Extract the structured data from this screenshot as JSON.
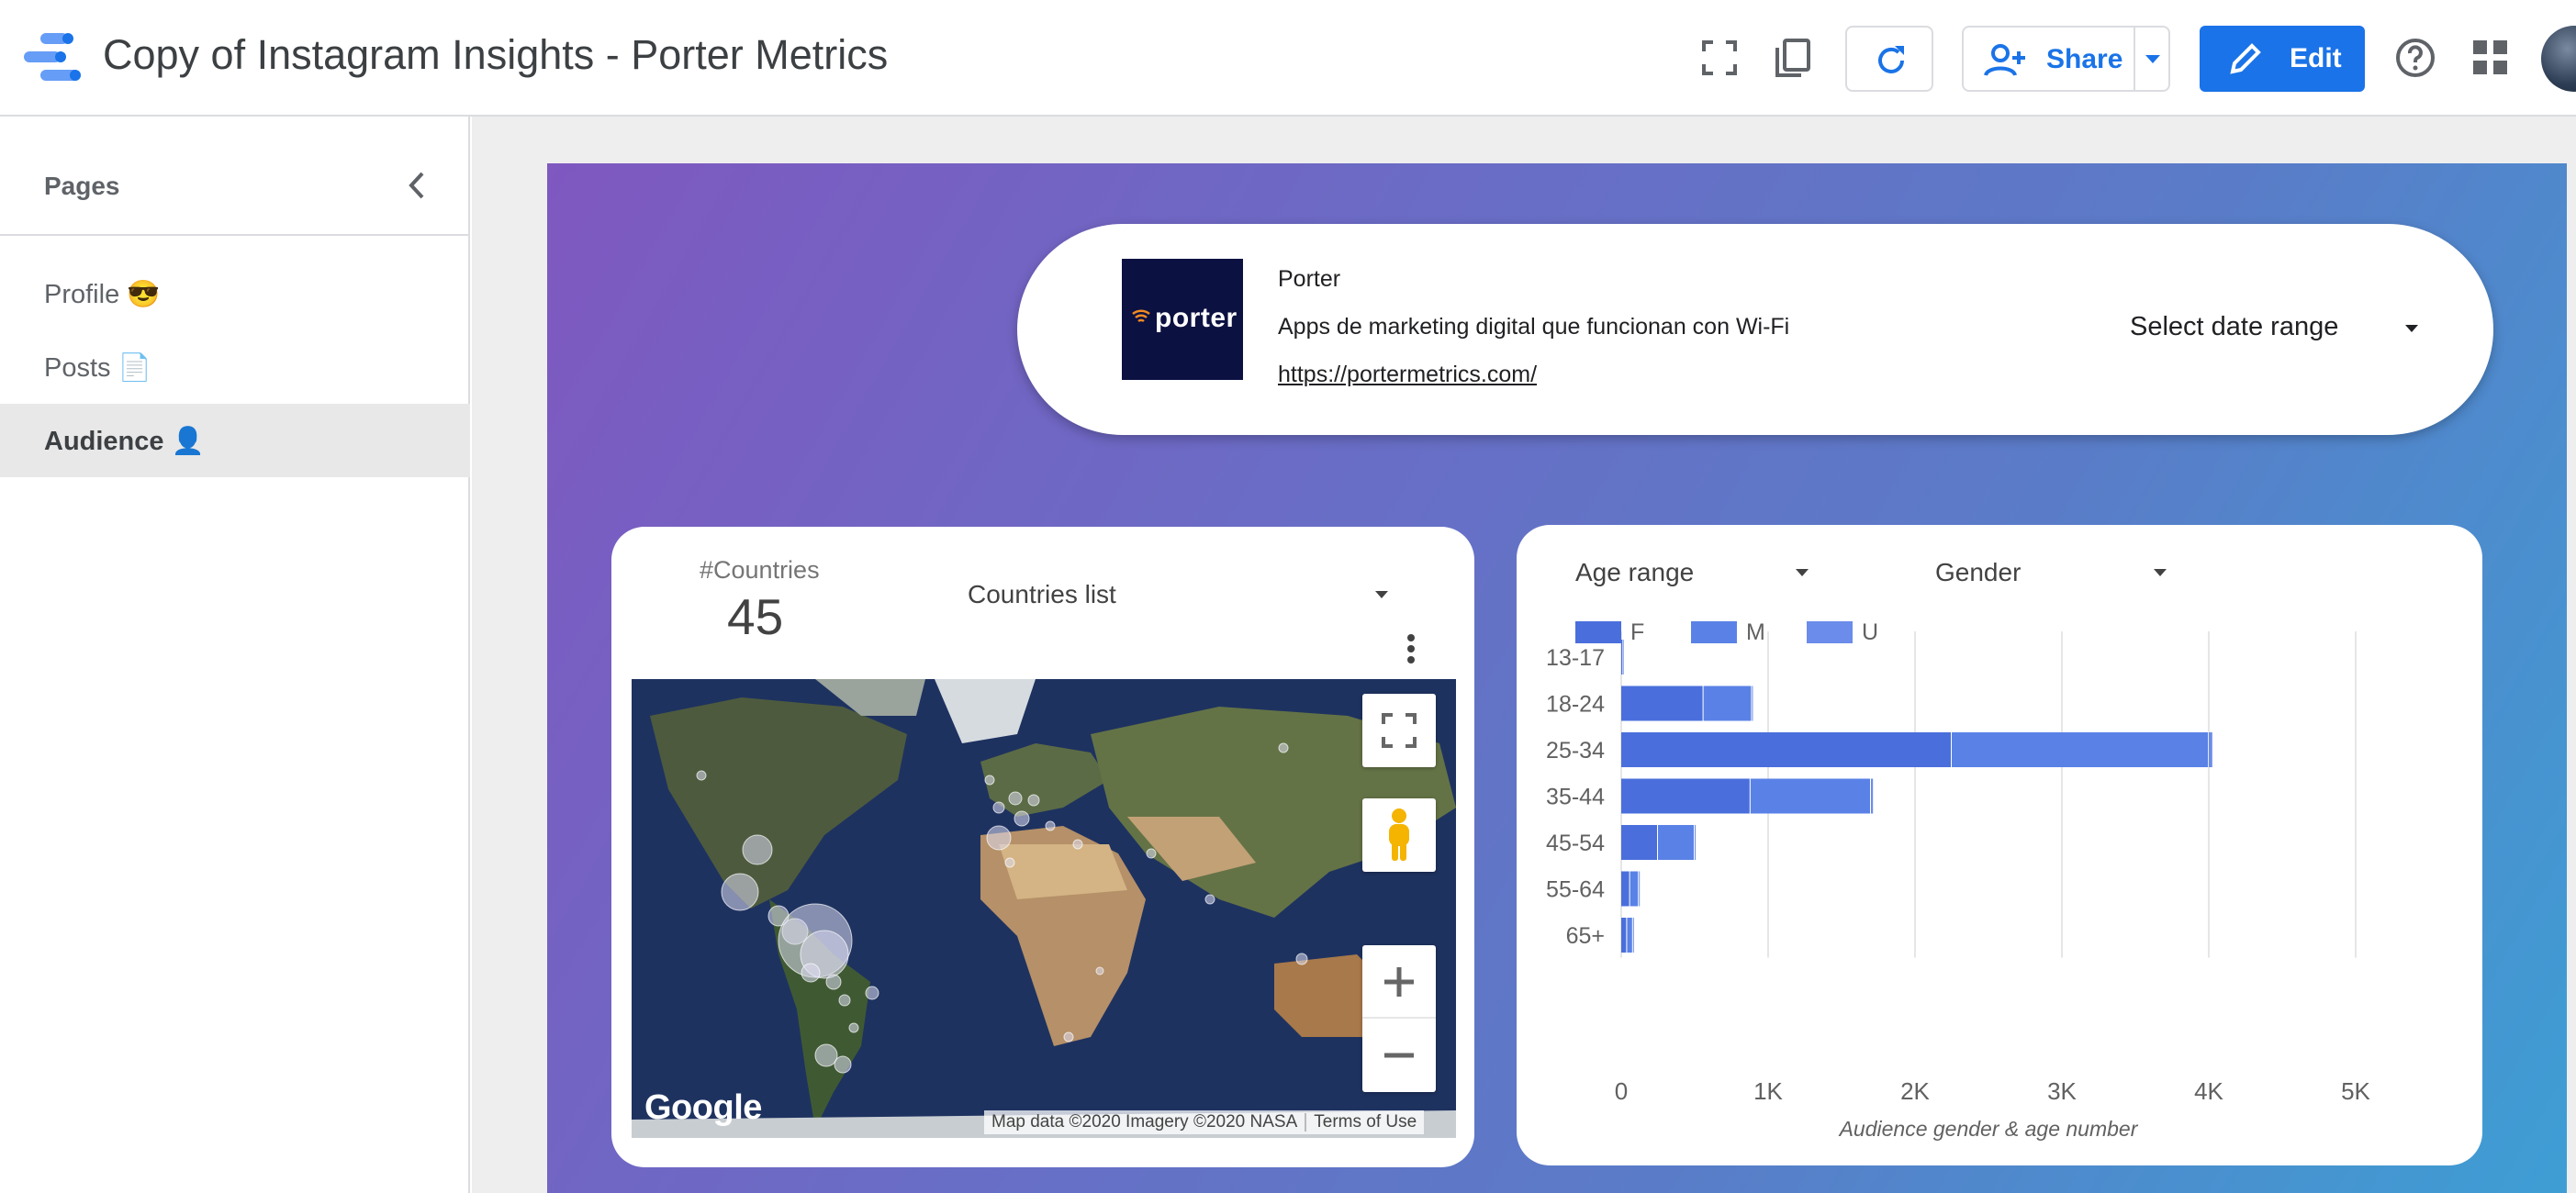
{
  "app": {
    "title": "Copy of Instagram Insights - Porter Metrics",
    "share_label": "Share",
    "edit_label": "Edit"
  },
  "sidebar": {
    "heading": "Pages",
    "items": [
      {
        "label": "Profile 😎",
        "active": false
      },
      {
        "label": "Posts 📄",
        "active": false
      },
      {
        "label": "Audience 👤",
        "active": true
      }
    ]
  },
  "header": {
    "logo_text": "porter",
    "company": "Porter",
    "description": "Apps de marketing digital que funcionan con Wi-Fi",
    "url": "https://portermetrics.com/",
    "date_range": "Select date range"
  },
  "map_card": {
    "kpi_label": "#Countries",
    "kpi_value": "45",
    "dropdown": "Countries list",
    "google": "Google",
    "attribution": "Map data ©2020 Imagery ©2020 NASA",
    "terms": "Terms of Use"
  },
  "chart_card": {
    "filter_age": "Age range",
    "filter_gender": "Gender"
  },
  "colors": {
    "accent": "#1a73e8",
    "bar_F": "#4a6fdc",
    "bar_M": "#5a82e6",
    "bar_U": "#6b8cea"
  },
  "chart_data": {
    "type": "bar",
    "orientation": "horizontal",
    "stacked": true,
    "categories": [
      "13-17",
      "18-24",
      "25-34",
      "35-44",
      "45-54",
      "55-64",
      "65+"
    ],
    "series": [
      {
        "name": "F",
        "values": [
          10,
          560,
          2250,
          880,
          250,
          60,
          40
        ]
      },
      {
        "name": "M",
        "values": [
          5,
          330,
          1750,
          820,
          250,
          60,
          40
        ]
      },
      {
        "name": "U",
        "values": [
          0,
          10,
          30,
          20,
          10,
          5,
          5
        ]
      }
    ],
    "xlim": [
      0,
      5000
    ],
    "xticks": [
      "0",
      "1K",
      "2K",
      "3K",
      "4K",
      "5K"
    ],
    "xtick_values": [
      0,
      1000,
      2000,
      3000,
      4000,
      5000
    ],
    "xlabel": "Audience gender & age number",
    "legend": "top-left",
    "grid": true
  }
}
